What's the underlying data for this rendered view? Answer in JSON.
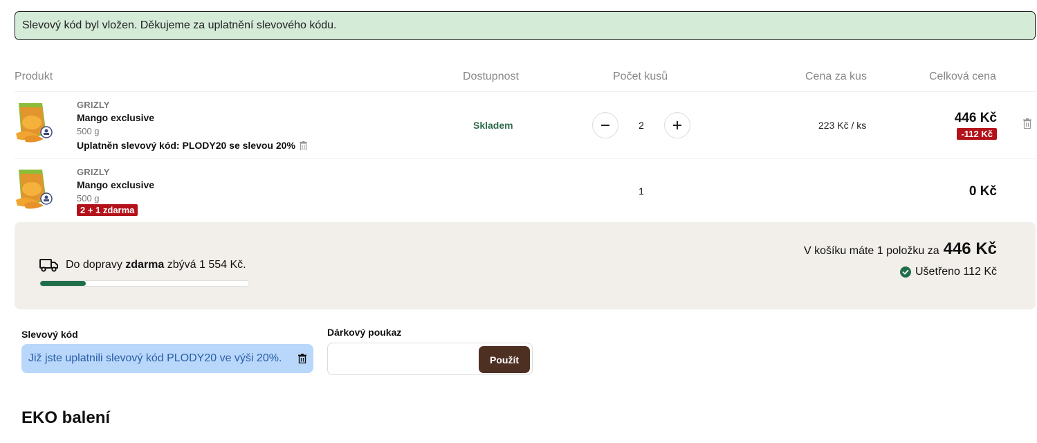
{
  "alert": {
    "message": "Slevový kód byl vložen. Děkujeme za uplatnění slevového kódu."
  },
  "table": {
    "headers": {
      "product": "Produkt",
      "availability": "Dostupnost",
      "quantity": "Počet kusů",
      "unit_price": "Cena za kus",
      "total": "Celková cena"
    },
    "rows": [
      {
        "brand": "GRIZLY",
        "name": "Mango exclusive",
        "weight": "500 g",
        "applied_code": "Uplatněn slevový kód: PLODY20 se slevou 20%",
        "availability": "Skladem",
        "qty": "2",
        "unit_price": "223 Kč / ks",
        "total": "446 Kč",
        "discount": "-112  Kč"
      },
      {
        "brand": "GRIZLY",
        "name": "Mango exclusive",
        "weight": "500 g",
        "promo": "2 + 1 zdarma",
        "qty": "1",
        "total": "0 Kč"
      }
    ]
  },
  "shipping": {
    "prefix": "Do dopravy ",
    "bold": "zdarma",
    "suffix": " zbývá 1 554 Kč.",
    "progress": 0.22
  },
  "cart_summary": {
    "text": "V košíku máte 1 položku za",
    "total": "446 Kč",
    "saved": "Ušetřeno 112  Kč"
  },
  "discount_code": {
    "label": "Slevový kód",
    "applied_text": "Již jste uplatnili slevový kód PLODY20 ve výši 20%."
  },
  "voucher": {
    "label": "Dárkový poukaz",
    "value": "",
    "button": "Použít"
  },
  "eko": {
    "heading": "EKO balení"
  },
  "colors": {
    "alert_bg": "#d4ebd8",
    "stock_green": "#2f6b4c",
    "discount_red": "#b4121b",
    "summary_bg": "#f2efea",
    "progress_fill": "#1f6e4a",
    "applied_code_bg": "#b8d7fb",
    "voucher_button": "#4e3023"
  }
}
